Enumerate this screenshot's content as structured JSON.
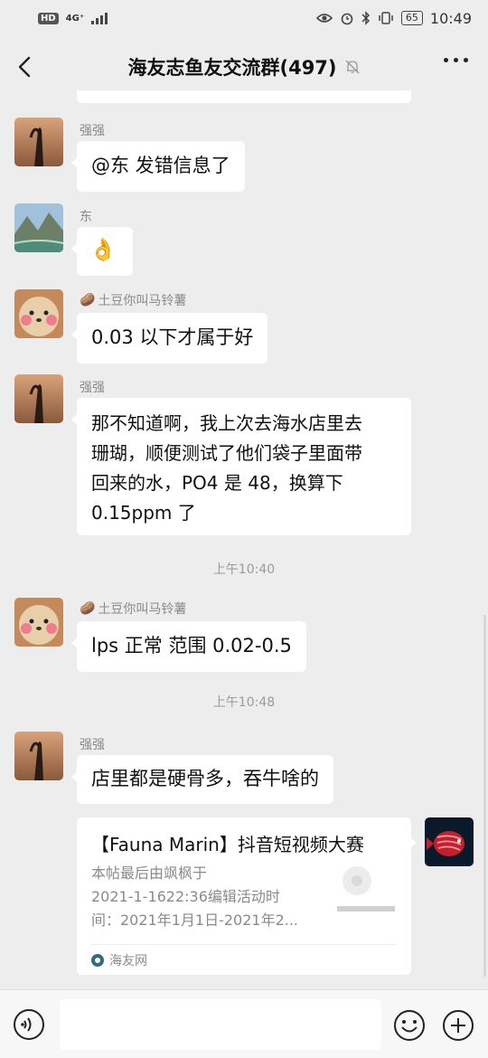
{
  "status_bar": {
    "hd": "HD",
    "network": "4G⁺",
    "battery": "65",
    "time": "10:49"
  },
  "header": {
    "title": "海友志鱼友交流群(497)",
    "icons": [
      "back-chevron-icon",
      "mute-bell-icon",
      "more-dots-icon"
    ]
  },
  "messages": [
    {
      "sender": "强强",
      "text": "@东 发错信息了"
    },
    {
      "sender": "东",
      "text": "👌"
    },
    {
      "sender_prefix": "🥔",
      "sender": "土豆你叫马铃薯",
      "text": "0.03 以下才属于好"
    },
    {
      "sender": "强强",
      "lines": [
        "那不知道啊，我上次去海水店里去",
        "珊瑚，顺便测试了他们袋子里面带",
        "回来的水，PO4 是 48，换算下",
        "0.15ppm 了"
      ]
    },
    {
      "sender_prefix": "🥔",
      "sender": "土豆你叫马铃薯",
      "text": "lps 正常  范围 0.02-0.5"
    },
    {
      "sender": "强强",
      "text": "店里都是硬骨多，吞牛啥的"
    }
  ],
  "time_labels": [
    "上午10:40",
    "上午10:48"
  ],
  "link_card": {
    "title": "【Fauna Marin】抖音短视频大赛",
    "desc_lines": [
      "本帖最后由飒枫于",
      "2021-1-1622:36编辑活动时",
      "间：2021年1月1日-2021年2..."
    ],
    "source": "海友网"
  },
  "input_bar": {
    "placeholder": "",
    "icons": [
      "voice-icon",
      "emoji-icon",
      "plus-icon"
    ]
  },
  "colors": {
    "background": "#ededed",
    "bubble": "#ffffff",
    "text": "#111111",
    "meta": "#8a8a8a"
  }
}
